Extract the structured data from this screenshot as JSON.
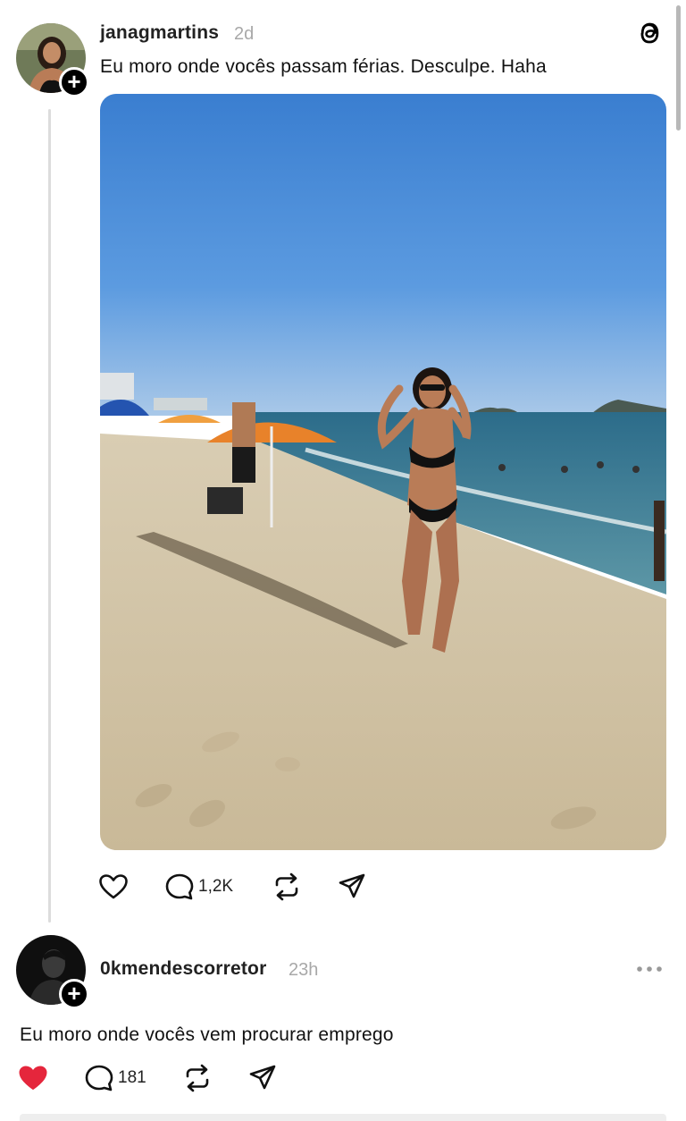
{
  "post": {
    "username": "janagmartins",
    "time": "2d",
    "text": "Eu moro onde vocês passam férias.  Desculpe. Haha",
    "image": "beach-photo",
    "actions": {
      "like_icon": "heart-outline-icon",
      "reply_count": "1,2K",
      "repost_icon": "repost-icon",
      "share_icon": "send-icon"
    }
  },
  "reply": {
    "username": "0kmendescorretor",
    "time": "23h",
    "text": "Eu moro onde vocês vem procurar emprego",
    "actions": {
      "like_icon": "heart-filled-icon",
      "reply_count": "181",
      "repost_icon": "repost-icon",
      "share_icon": "send-icon"
    }
  },
  "colors": {
    "like_active": "#e5263c",
    "muted_text": "#a8a8a8",
    "thread_line": "#dcdcdc"
  }
}
